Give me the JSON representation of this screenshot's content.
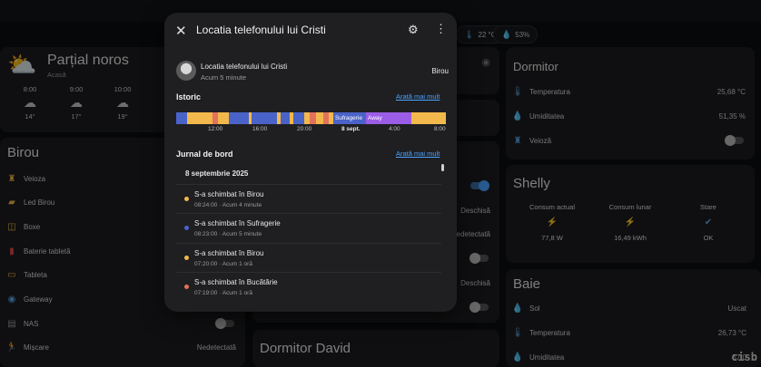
{
  "pills": [
    {
      "icon": "thermometer-icon",
      "glyph": "🌡",
      "text": "22 °C"
    },
    {
      "icon": "water-drop-icon",
      "glyph": "💧",
      "text": "53%"
    }
  ],
  "weather": {
    "condition": "Parțial noros",
    "location": "Acasă",
    "hours": [
      {
        "time": "8:00",
        "temp": "14°"
      },
      {
        "time": "9:00",
        "temp": "17°"
      },
      {
        "time": "10:00",
        "temp": "19°"
      }
    ]
  },
  "birou": {
    "title": "Birou",
    "rows": [
      {
        "label": "Veioza",
        "icon": "lamp-icon",
        "glyph": "♜"
      },
      {
        "label": "Led Birou",
        "icon": "led-strip-icon",
        "glyph": "▰"
      },
      {
        "label": "Boxe",
        "icon": "speaker-icon",
        "glyph": "◫"
      },
      {
        "label": "Baterie tabletă",
        "icon": "battery-icon",
        "glyph": "▮"
      },
      {
        "label": "Tableta",
        "icon": "tablet-icon",
        "glyph": "▭"
      },
      {
        "label": "Gateway",
        "icon": "gateway-icon",
        "glyph": "◉"
      },
      {
        "label": "NAS",
        "icon": "nas-icon",
        "glyph": "▤"
      },
      {
        "label": "Mișcare",
        "icon": "motion-icon",
        "glyph": "🏃",
        "value": "Nedetectată"
      }
    ]
  },
  "middle": {
    "values": [
      "Deschisă",
      "Nedetectată",
      "Deschisă"
    ],
    "bottom_title": "Dormitor David"
  },
  "dormitor": {
    "title": "Dormitor",
    "rows": [
      {
        "label": "Temperatura",
        "value": "25,68 °C",
        "icon": "thermometer-icon",
        "glyph": "🌡"
      },
      {
        "label": "Umiditatea",
        "value": "51,35 %",
        "icon": "humidity-icon",
        "glyph": "💧"
      },
      {
        "label": "Veioză",
        "icon": "lamp-icon",
        "glyph": "♜"
      }
    ]
  },
  "shelly": {
    "title": "Shelly",
    "cols": [
      {
        "label": "Consum actual",
        "value": "77,8 W",
        "icon": "flash-icon",
        "glyph": "⚡"
      },
      {
        "label": "Consum lunar",
        "value": "16,49 kWh",
        "icon": "flash-icon",
        "glyph": "⚡"
      },
      {
        "label": "Stare",
        "value": "OK",
        "icon": "check-circle-icon",
        "glyph": "✔"
      }
    ]
  },
  "baie": {
    "title": "Baie",
    "rows": [
      {
        "label": "Sol",
        "value": "Uscat",
        "icon": "water-off-icon",
        "glyph": "💧"
      },
      {
        "label": "Temperatura",
        "value": "26,73 °C",
        "icon": "thermometer-icon",
        "glyph": "🌡"
      },
      {
        "label": "Umiditatea",
        "value": "57,0",
        "icon": "humidity-icon",
        "glyph": "💧"
      }
    ]
  },
  "dialog": {
    "title": "Locatia telefonului lui Cristi",
    "entity_name": "Locatia telefonului lui Cristi",
    "entity_time": "Acum 5 minute",
    "entity_state": "Birou",
    "history_title": "Istoric",
    "more_link": "Arată mai mult",
    "timeline_labels": {
      "suf": "Sufragerie",
      "away": "Away"
    },
    "ticks": [
      "12:00",
      "16:00",
      "20:00",
      "8 sept.",
      "4:00",
      "8:00"
    ],
    "logbook_title": "Jurnal de bord",
    "log_date": "8 septembrie 2025",
    "log": [
      {
        "text": "S-a schimbat în Birou",
        "sub": "08:24:00 · Acum 4 minute",
        "color": "#f2b84b"
      },
      {
        "text": "S-a schimbat în Sufragerie",
        "sub": "08:23:00 · Acum 5 minute",
        "color": "#4a63c9"
      },
      {
        "text": "S-a schimbat în Birou",
        "sub": "07:20:00 · Acum 1 oră",
        "color": "#f2b84b"
      },
      {
        "text": "S-a schimbat în Bucătărie",
        "sub": "07:19:00 · Acum 1 oră",
        "color": "#e2725b"
      }
    ]
  },
  "colors": {
    "birou": "#f2b84b",
    "sufragerie": "#4a63c9",
    "away": "#9b5de5",
    "bucatarie": "#e2725b"
  },
  "watermark": "cisb"
}
